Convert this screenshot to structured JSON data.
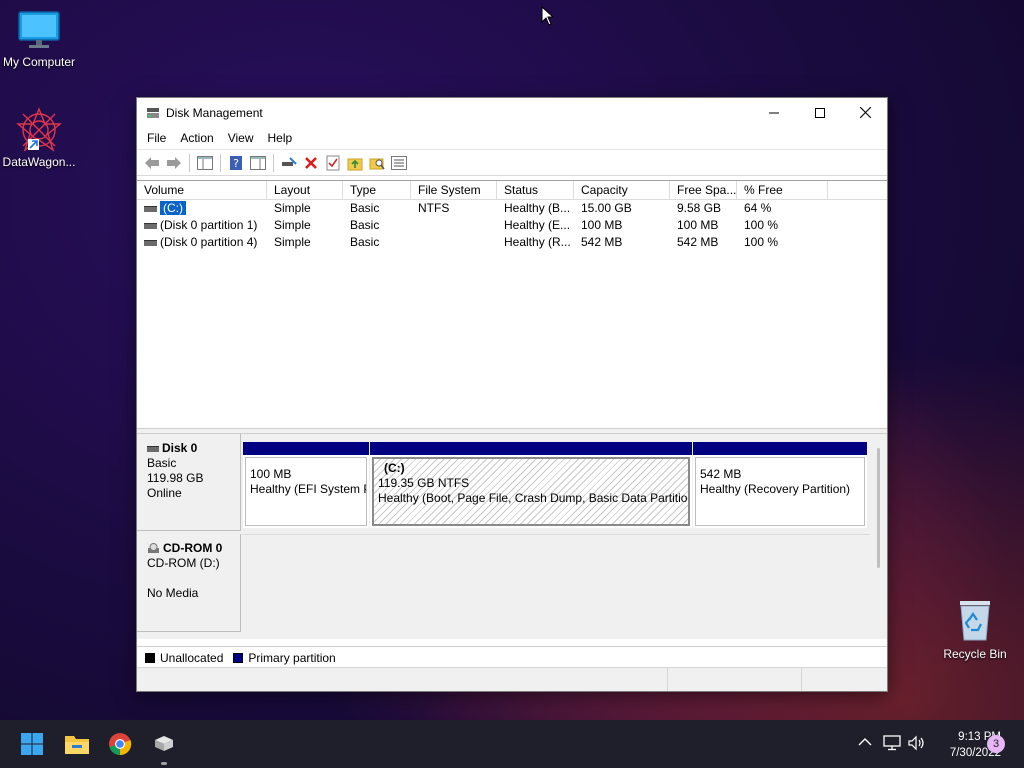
{
  "desktop": {
    "icons": [
      {
        "label": "My Computer"
      },
      {
        "label": "DataWagon..."
      },
      {
        "label": "Recycle Bin"
      }
    ]
  },
  "window": {
    "title": "Disk Management",
    "menu": [
      "File",
      "Action",
      "View",
      "Help"
    ],
    "columns": [
      "Volume",
      "Layout",
      "Type",
      "File System",
      "Status",
      "Capacity",
      "Free Spa...",
      "% Free"
    ],
    "volumes": [
      {
        "volume": "(C:)",
        "layout": "Simple",
        "type": "Basic",
        "fs": "NTFS",
        "status": "Healthy (B...",
        "capacity": "15.00 GB",
        "free": "9.58 GB",
        "pct": "64 %"
      },
      {
        "volume": "(Disk 0 partition 1)",
        "layout": "Simple",
        "type": "Basic",
        "fs": "",
        "status": "Healthy (E...",
        "capacity": "100 MB",
        "free": "100 MB",
        "pct": "100 %"
      },
      {
        "volume": "(Disk 0 partition 4)",
        "layout": "Simple",
        "type": "Basic",
        "fs": "",
        "status": "Healthy (R...",
        "capacity": "542 MB",
        "free": "542 MB",
        "pct": "100 %"
      }
    ],
    "disks": [
      {
        "name": "Disk 0",
        "type": "Basic",
        "size": "119.98 GB",
        "state": "Online",
        "partitions": [
          {
            "title": "",
            "line1": "100 MB",
            "line2": "Healthy (EFI System Partition)"
          },
          {
            "title": "(C:)",
            "line1": "119.35 GB NTFS",
            "line2": "Healthy (Boot, Page File, Crash Dump, Basic Data Partition)"
          },
          {
            "title": "",
            "line1": "542 MB",
            "line2": "Healthy (Recovery Partition)"
          }
        ]
      },
      {
        "name": "CD-ROM 0",
        "type": "CD-ROM (D:)",
        "size": "",
        "state": "No Media"
      }
    ],
    "legend": [
      {
        "label": "Unallocated",
        "color": "#000000"
      },
      {
        "label": "Primary partition",
        "color": "#000080"
      }
    ]
  },
  "taskbar": {
    "time": "9:13 PM",
    "date": "7/30/2022",
    "notifications": "3"
  }
}
